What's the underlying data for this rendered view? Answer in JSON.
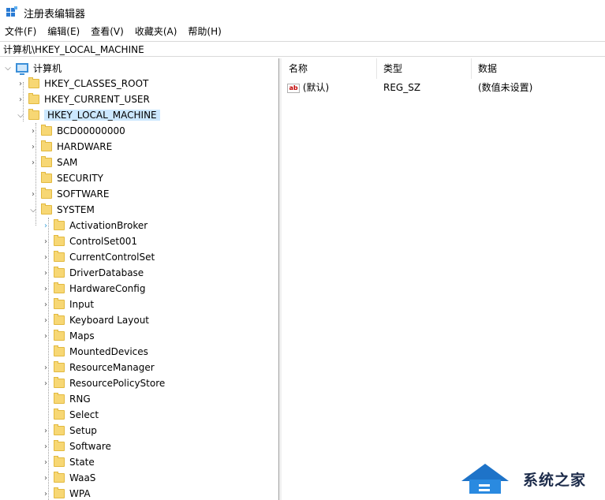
{
  "window": {
    "title": "注册表编辑器"
  },
  "menu": [
    "文件(F)",
    "编辑(E)",
    "查看(V)",
    "收藏夹(A)",
    "帮助(H)"
  ],
  "address": "计算机\\HKEY_LOCAL_MACHINE",
  "tree": {
    "root": "计算机",
    "hives": [
      "HKEY_CLASSES_ROOT",
      "HKEY_CURRENT_USER",
      "HKEY_LOCAL_MACHINE"
    ],
    "hklm_children": [
      "BCD00000000",
      "HARDWARE",
      "SAM",
      "SECURITY",
      "SOFTWARE",
      "SYSTEM"
    ],
    "system_children": [
      "ActivationBroker",
      "ControlSet001",
      "CurrentControlSet",
      "DriverDatabase",
      "HardwareConfig",
      "Input",
      "Keyboard Layout",
      "Maps",
      "MountedDevices",
      "ResourceManager",
      "ResourcePolicyStore",
      "RNG",
      "Select",
      "Setup",
      "Software",
      "State",
      "WaaS",
      "WPA"
    ]
  },
  "list": {
    "headers": {
      "name": "名称",
      "type": "类型",
      "data": "数据"
    },
    "rows": [
      {
        "name": "(默认)",
        "type": "REG_SZ",
        "data": "(数值未设置)",
        "icon": "ab"
      }
    ]
  },
  "watermark": {
    "text": "系统之家"
  }
}
